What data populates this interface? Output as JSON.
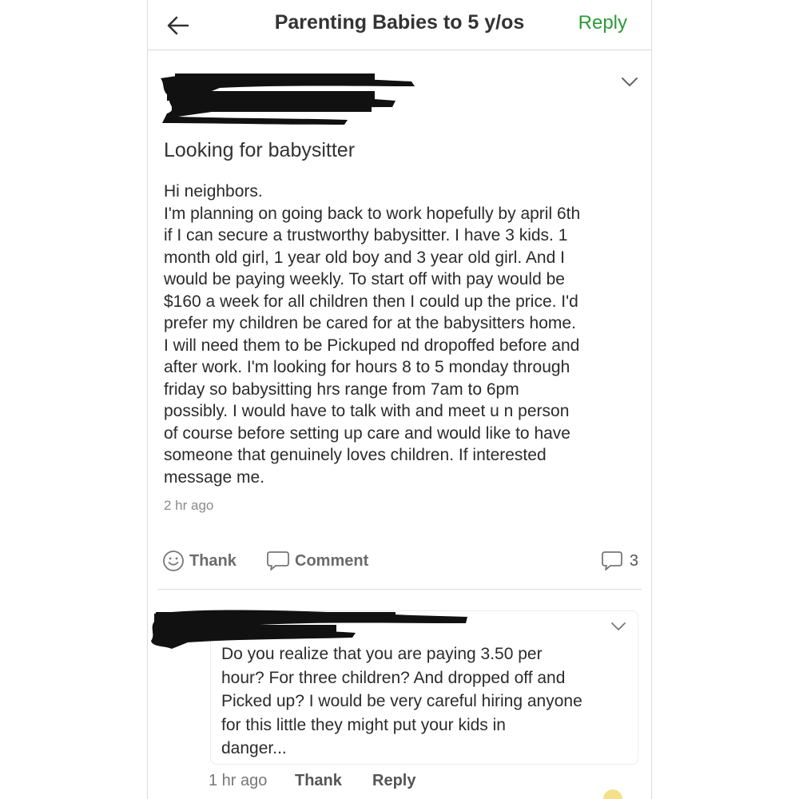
{
  "header": {
    "title": "Parenting Babies to 5 y/os",
    "reply_label": "Reply"
  },
  "post": {
    "title": "Looking for babysitter",
    "body_lines": [
      "Hi neighbors.",
      "I'm planning on going back to work hopefully by april 6th",
      "if I can secure a trustworthy babysitter. I have 3 kids. 1",
      "month old girl, 1 year old boy and 3 year old girl. And I",
      "would be paying weekly. To start off with pay would be",
      "$160 a week for all children then I could up the price. I'd",
      "prefer my children be cared for at the babysitters home.",
      "I will need them to be Pickuped nd dropoffed before and",
      "after work. I'm looking for hours 8 to 5 monday through",
      "friday so babysitting hrs range from 7am to 6pm",
      "possibly. I would have to talk with and meet u n person",
      "of course before setting up care and would like to have",
      "someone that genuinely loves children. If interested",
      "message me."
    ],
    "timestamp": "2 hr ago",
    "actions": {
      "thank_label": "Thank",
      "comment_label": "Comment",
      "comment_count": "3"
    }
  },
  "reply": {
    "text_lines": [
      "Do you realize that you are paying 3.50 per",
      "hour?  For three children? And dropped off and",
      "Picked up? I would be very careful hiring anyone",
      "for this little they might put your kids in",
      "danger..."
    ],
    "time": "1 hr ago",
    "thank_label": "Thank",
    "reply_label": "Reply"
  },
  "colors": {
    "accent_green": "#2c9a3b",
    "redaction": "#111111"
  },
  "icons": [
    "back-arrow-icon",
    "chevron-down-icon",
    "smiley-icon",
    "comment-bubble-icon"
  ]
}
